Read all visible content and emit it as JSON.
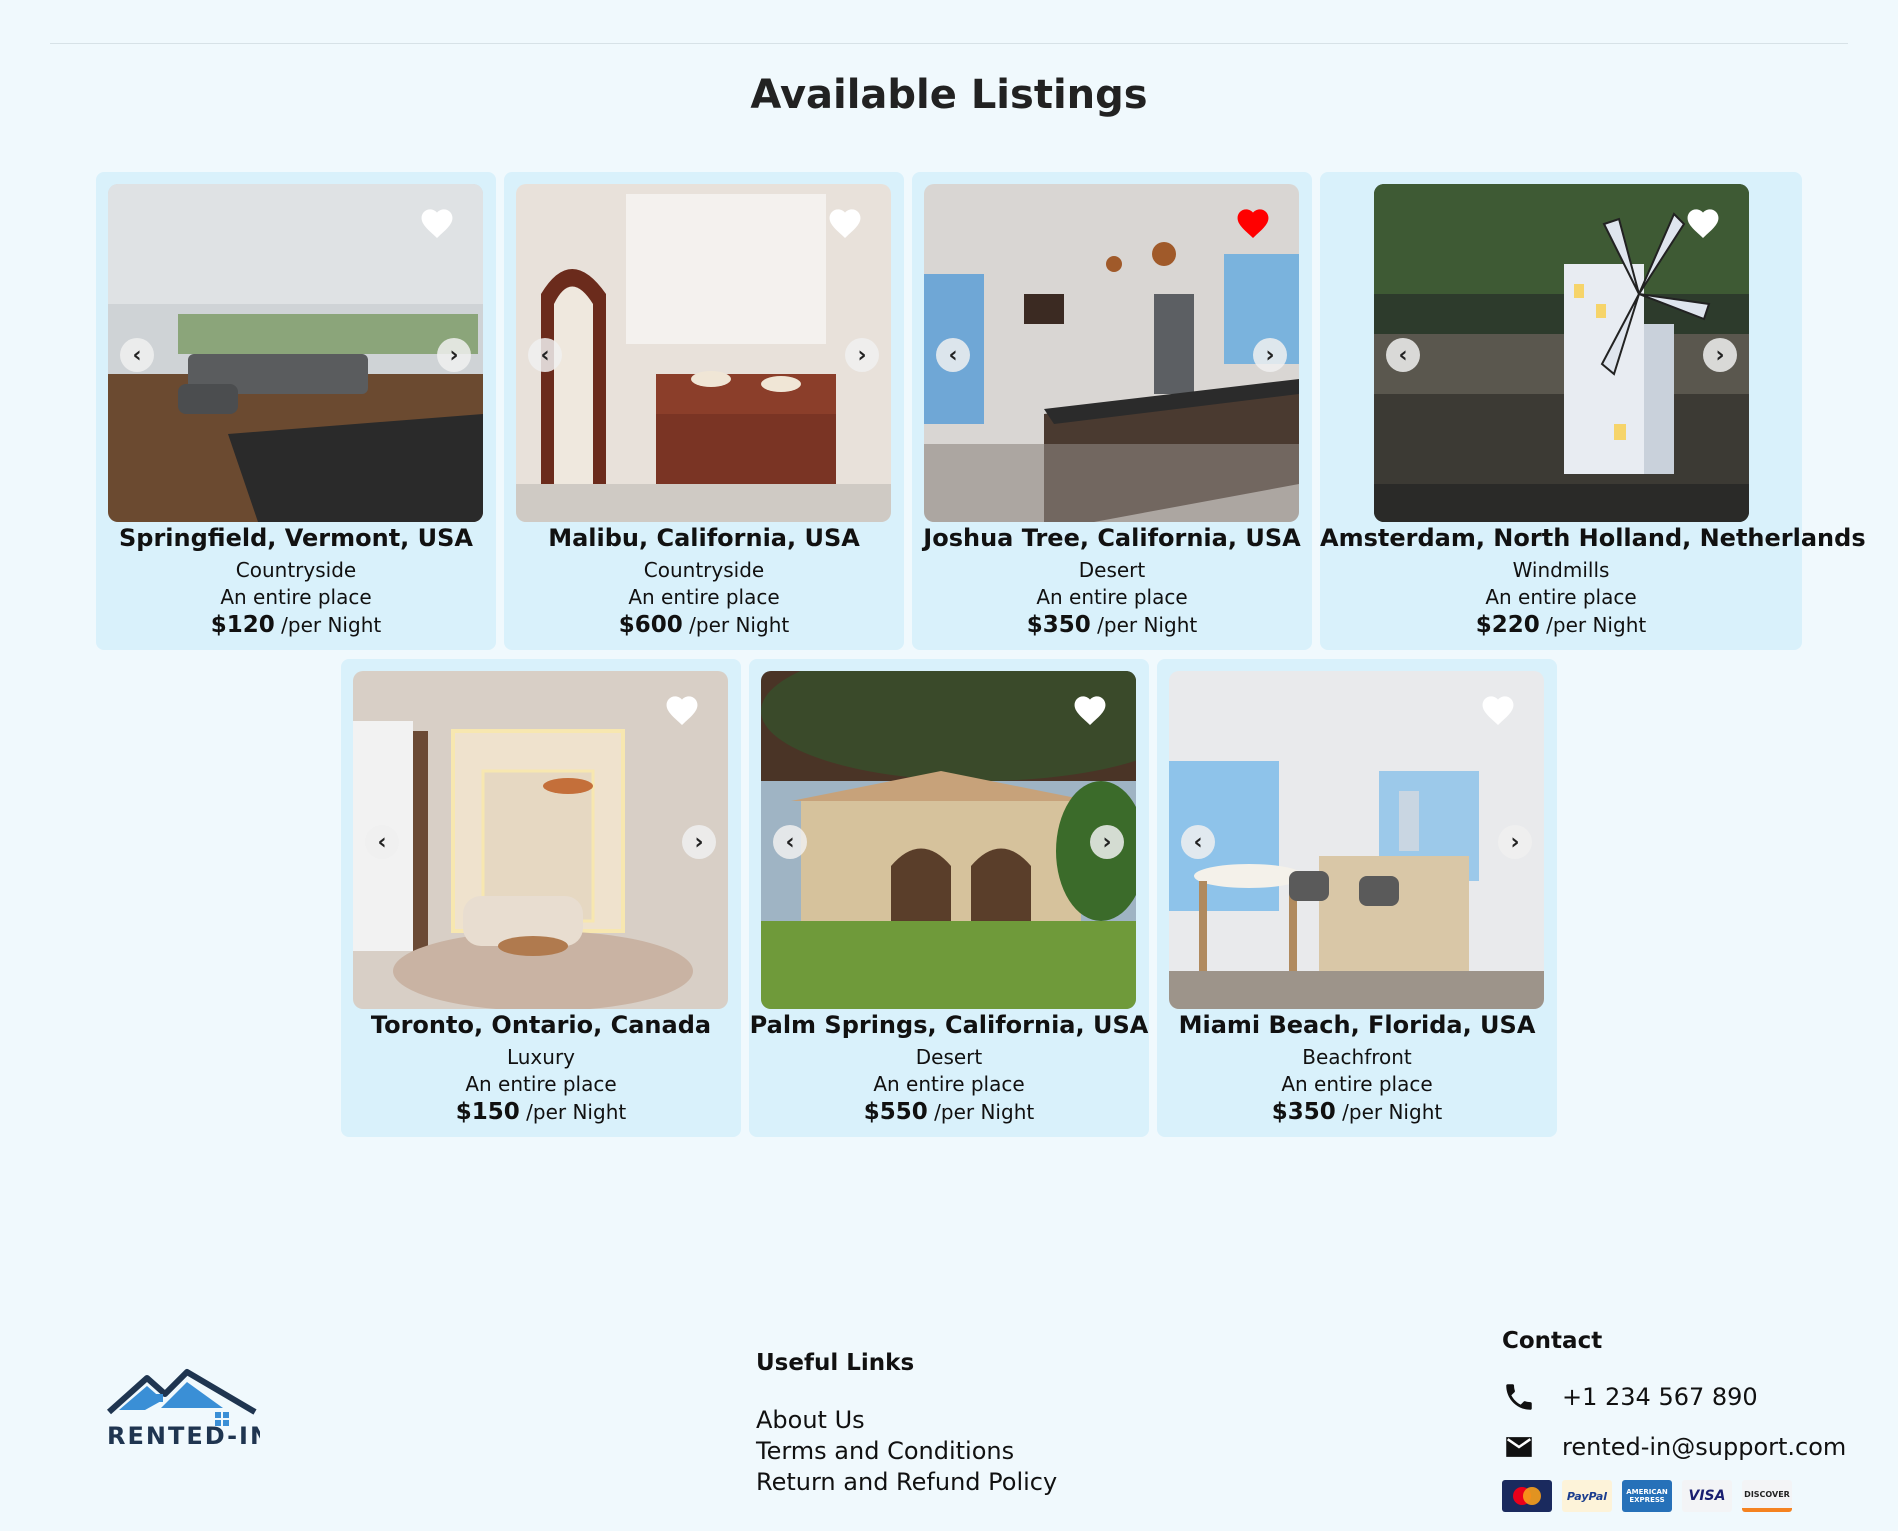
{
  "page": {
    "title": "Available Listings"
  },
  "listings": [
    {
      "city": "Springfield, Vermont, USA",
      "type": "Countryside",
      "place": "An entire place",
      "price": "$120",
      "per": "/per Night",
      "favorited": false
    },
    {
      "city": "Malibu, California, USA",
      "type": "Countryside",
      "place": "An entire place",
      "price": "$600",
      "per": "/per Night",
      "favorited": false
    },
    {
      "city": "Joshua Tree, California, USA",
      "type": "Desert",
      "place": "An entire place",
      "price": "$350",
      "per": "/per Night",
      "favorited": true
    },
    {
      "city": "Amsterdam, North Holland, Netherlands",
      "type": "Windmills",
      "place": "An entire place",
      "price": "$220",
      "per": "/per Night",
      "favorited": false
    },
    {
      "city": "Toronto, Ontario, Canada",
      "type": "Luxury",
      "place": "An entire place",
      "price": "$150",
      "per": "/per Night",
      "favorited": false
    },
    {
      "city": "Palm Springs, California, USA",
      "type": "Desert",
      "place": "An entire place",
      "price": "$550",
      "per": "/per Night",
      "favorited": false
    },
    {
      "city": "Miami Beach, Florida, USA",
      "type": "Beachfront",
      "place": "An entire place",
      "price": "$350",
      "per": "/per Night",
      "favorited": false
    }
  ],
  "footer": {
    "logo_text": "RENTED-IN",
    "links_title": "Useful Links",
    "links": [
      "About Us",
      "Terms and Conditions",
      "Return and Refund Policy"
    ],
    "contact_title": "Contact",
    "phone": "+1 234 567 890",
    "email": "rented-in@support.com",
    "payments": [
      "MasterCard",
      "PayPal",
      "AMERICAN EXPRESS",
      "VISA",
      "DISCOVER"
    ]
  },
  "colors": {
    "background": "#f0f9fd",
    "card": "#d9f1fb",
    "heart_active": "#ff0000",
    "heart_inactive": "#ffffff",
    "logo_blue": "#3a8fd6"
  }
}
